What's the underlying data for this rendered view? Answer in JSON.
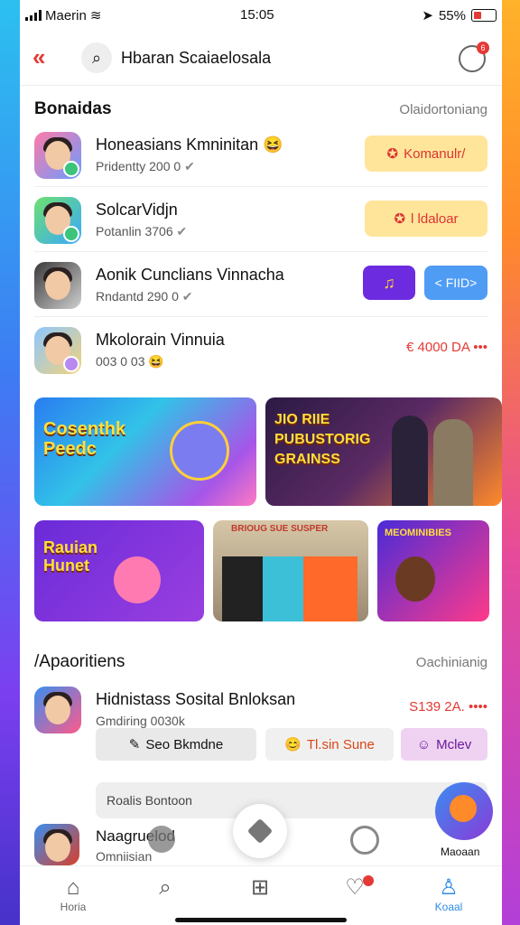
{
  "status": {
    "carrier": "Maerin",
    "time": "15:05",
    "battery": "55%"
  },
  "header": {
    "search_text": "Hbaran Scaiaelosala",
    "notif_count": "6"
  },
  "section1": {
    "title": "Bonaidas",
    "action": "Olaidortoniang",
    "rows": [
      {
        "name": "Honeasians Kmninitan",
        "sub": "Pridentty 200 0",
        "button": "Komanulr/"
      },
      {
        "name": "SolcarVidjn",
        "sub": "Potanlin 3706",
        "button": "l ldaloar"
      },
      {
        "name": "Aonik Cunclians Vinnacha",
        "sub": "Rndantd 290 0",
        "button_blue": "< FIID>"
      },
      {
        "name": "Mkolorain Vinnuia",
        "sub": "003 0 03",
        "price": "€ 4000 DA"
      }
    ]
  },
  "cards": {
    "card1": "Cosenthk Peedc",
    "card2": "JIO RIIE PUBUSTORIG GRAINSS",
    "card3": "Rauian Hunet",
    "card4": "BRIOUG SUE SUSPER",
    "card5": "MEOMINIBIES"
  },
  "section2": {
    "title": "/Apaoritiens",
    "action": "Oachinianig",
    "name": "Hidnistass Sosital Bnloksan",
    "sub": "Gmdiring 0030k",
    "price": "S139 2A.",
    "chips": [
      "Seo Bkmdne",
      "Tl.sin Sune",
      "Mclev"
    ],
    "input": "Roalis Bontoon",
    "fab_label": "Maoaan"
  },
  "bottom_row": {
    "name": "Naagruelod",
    "sub": "Omniisian"
  },
  "tabbar": {
    "home": "Horia",
    "social": "Koaal"
  },
  "colors": {
    "accent": "#e53935",
    "yellow": "#ffe59a",
    "purple": "#6d2be0",
    "blue": "#4f9cf5",
    "tab_active": "#2f8de6"
  }
}
